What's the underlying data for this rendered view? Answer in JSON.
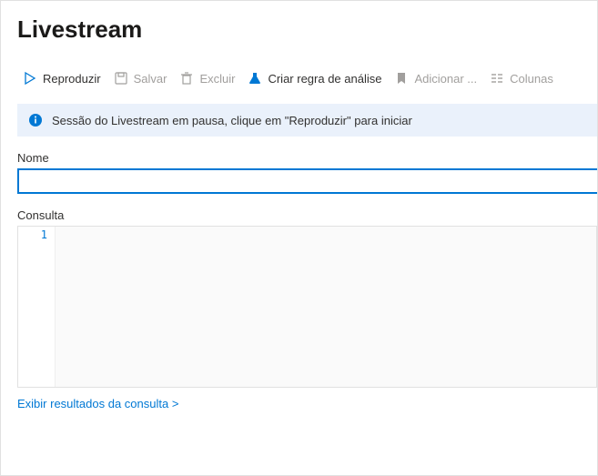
{
  "header": {
    "title": "Livestream"
  },
  "toolbar": {
    "play": {
      "label": "Reproduzir",
      "enabled": true
    },
    "save": {
      "label": "Salvar",
      "enabled": false
    },
    "delete": {
      "label": "Excluir",
      "enabled": false
    },
    "rule": {
      "label": "Criar regra de análise",
      "enabled": true
    },
    "addbm": {
      "label": "Adicionar ...",
      "enabled": false
    },
    "cols": {
      "label": "Colunas",
      "enabled": false
    }
  },
  "info": {
    "message": "Sessão do Livestream em pausa, clique em \"Reproduzir\" para iniciar"
  },
  "name_section": {
    "label": "Nome",
    "value": ""
  },
  "query_section": {
    "label": "Consulta",
    "line_number": "1",
    "content": ""
  },
  "footer": {
    "view_results": "Exibir resultados da consulta  >"
  }
}
